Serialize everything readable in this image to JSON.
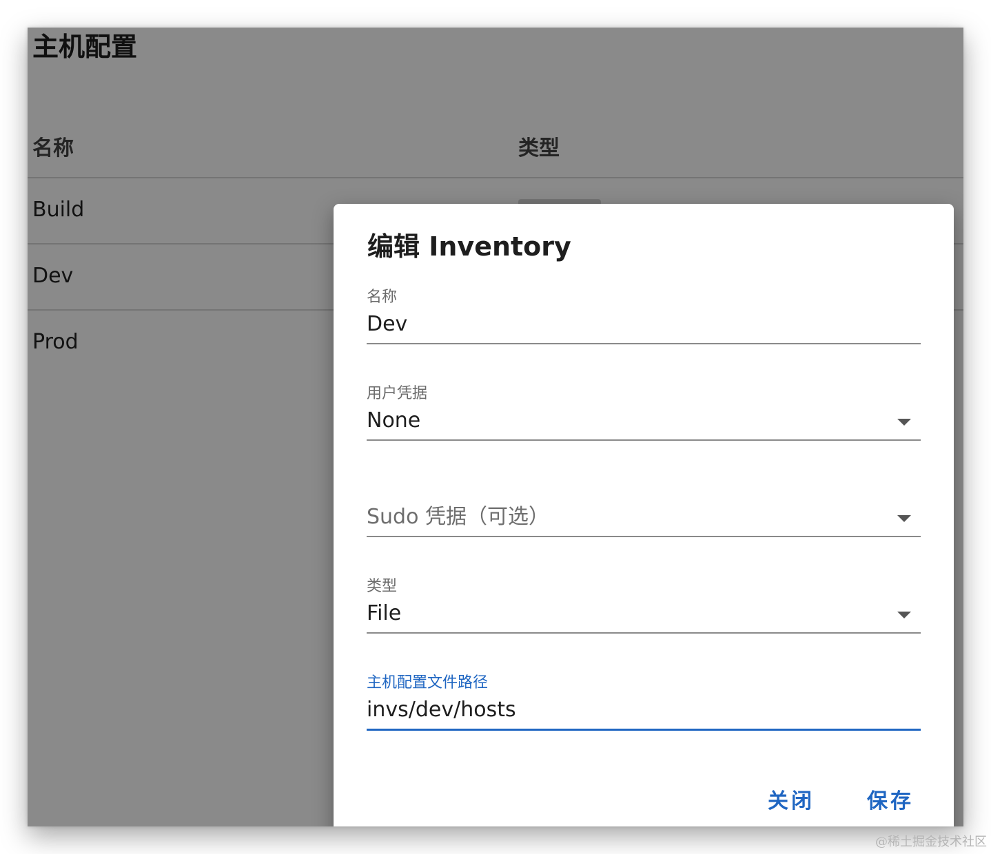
{
  "page": {
    "title": "主机配置"
  },
  "table": {
    "columns": [
      "名称",
      "类型"
    ],
    "rows": [
      {
        "name": "Build"
      },
      {
        "name": "Dev"
      },
      {
        "name": "Prod"
      }
    ]
  },
  "dialog": {
    "title": "编辑 Inventory",
    "fields": {
      "name": {
        "label": "名称",
        "value": "Dev"
      },
      "user_credential": {
        "label": "用户凭据",
        "value": "None",
        "icon": "chevron-down-icon"
      },
      "sudo_credential": {
        "placeholder": "Sudo 凭据（可选）",
        "icon": "chevron-down-icon"
      },
      "type": {
        "label": "类型",
        "value": "File",
        "icon": "chevron-down-icon"
      },
      "inventory_path": {
        "label": "主机配置文件路径",
        "value": "invs/dev/hosts",
        "focused": true
      }
    },
    "actions": {
      "close": "关闭",
      "save": "保存"
    }
  },
  "watermark": "@稀土掘金技术社区",
  "colors": {
    "accent": "#1f66c2",
    "scrim": "rgba(0,0,0,0.46)"
  }
}
